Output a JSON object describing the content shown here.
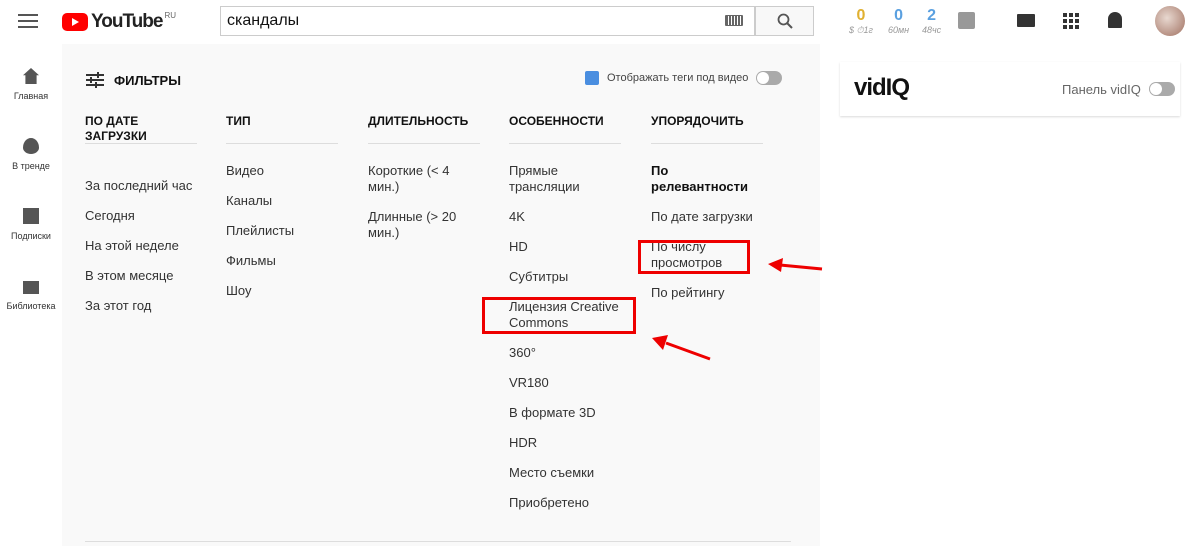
{
  "header": {
    "logo_text": "YouTube",
    "logo_region": "RU",
    "search_value": "скандалы",
    "stats": [
      {
        "value": "0",
        "label": "$ ⏱1г",
        "color": "#e0b030"
      },
      {
        "value": "0",
        "label": "60мн",
        "color": "#5aa0e0"
      },
      {
        "value": "2",
        "label": "48чс",
        "color": "#5aa0e0"
      }
    ]
  },
  "sidebar": [
    {
      "label": "Главная"
    },
    {
      "label": "В тренде"
    },
    {
      "label": "Подписки"
    },
    {
      "label": "Библиотека"
    }
  ],
  "filters": {
    "title": "ФИЛЬТРЫ",
    "tags_toggle_label": "Отображать теги под видео",
    "columns": [
      {
        "title": "ПО ДАТЕ ЗАГРУЗКИ",
        "items": [
          "За последний час",
          "Сегодня",
          "На этой неделе",
          "В этом месяце",
          "За этот год"
        ]
      },
      {
        "title": "ТИП",
        "items": [
          "Видео",
          "Каналы",
          "Плейлисты",
          "Фильмы",
          "Шоу"
        ]
      },
      {
        "title": "ДЛИТЕЛЬНОСТЬ",
        "items": [
          "Короткие (< 4 мин.)",
          "Длинные (> 20 мин.)"
        ]
      },
      {
        "title": "ОСОБЕННОСТИ",
        "items": [
          "Прямые трансляции",
          "4K",
          "HD",
          "Субтитры",
          "Лицензия Creative Commons",
          "360°",
          "VR180",
          "В формате 3D",
          "HDR",
          "Место съемки",
          "Приобретено"
        ]
      },
      {
        "title": "УПОРЯДОЧИТЬ",
        "items": [
          "По релевантности",
          "По дате загрузки",
          "По числу просмотров",
          "По рейтингу"
        ],
        "selected": 0
      }
    ]
  },
  "vidiq": {
    "logo": "vidIQ",
    "panel_label": "Панель vidIQ"
  }
}
